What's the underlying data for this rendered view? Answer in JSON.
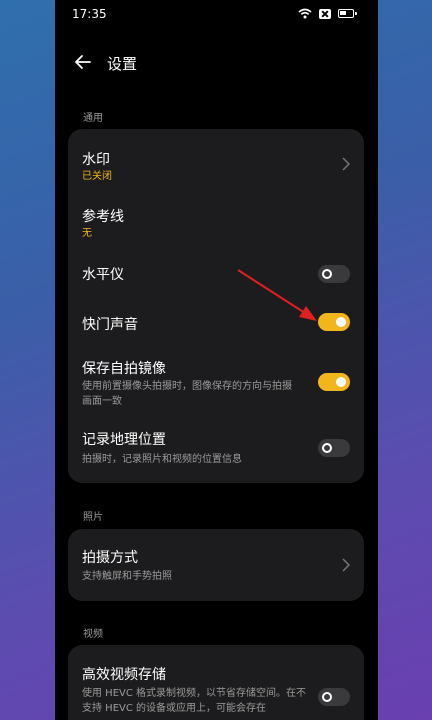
{
  "status": {
    "time": "17:35"
  },
  "header": {
    "title": "设置"
  },
  "sections": {
    "general": "通用",
    "photo": "照片",
    "video": "视频"
  },
  "general": {
    "watermark": {
      "title": "水印",
      "value": "已关闭"
    },
    "gridlines": {
      "title": "参考线",
      "value": "无"
    },
    "level": {
      "title": "水平仪",
      "toggle": "off"
    },
    "shutter_sound": {
      "title": "快门声音",
      "toggle": "on"
    },
    "mirror_selfie": {
      "title": "保存自拍镜像",
      "desc": "使用前置摄像头拍摄时，图像保存的方向与拍摄画面一致",
      "toggle": "on"
    },
    "location": {
      "title": "记录地理位置",
      "desc": "拍摄时，记录照片和视频的位置信息",
      "toggle": "off"
    }
  },
  "photo": {
    "shoot_method": {
      "title": "拍摄方式",
      "desc": "支持触屏和手势拍照"
    }
  },
  "video": {
    "hevc": {
      "title": "高效视频存储",
      "desc": "使用 HEVC 格式录制视频，以节省存储空间。在不支持 HEVC 的设备或应用上，可能会存在",
      "toggle": "off"
    }
  },
  "colors": {
    "accent": "#f2b51b",
    "card": "#1c1c1e",
    "arrow": "#e02020"
  }
}
